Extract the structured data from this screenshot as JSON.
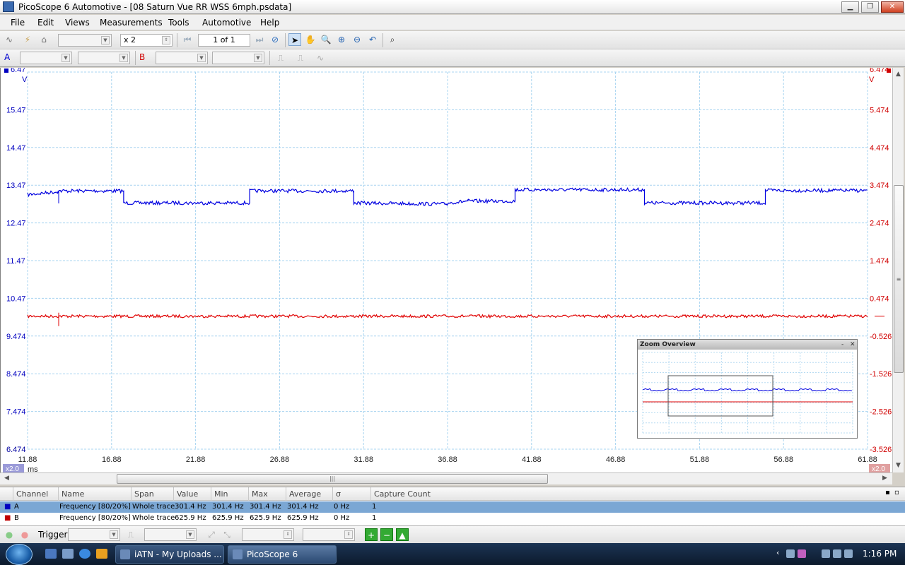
{
  "window": {
    "title": "PicoScope 6 Automotive - [08 Saturn Vue RR WSS 6mph.psdata]",
    "btn_minimize": "▁",
    "btn_maximize": "❐",
    "btn_close": "✕"
  },
  "menu": {
    "items": [
      "File",
      "Edit",
      "Views",
      "Measurements",
      "Tools",
      "Automotive",
      "Help"
    ]
  },
  "toolbar": {
    "zoom_value": "x 2",
    "page_value": "1 of 1"
  },
  "toolbar2": {
    "channel_a": "A",
    "channel_b": "B"
  },
  "plot": {
    "left_axis_labels": [
      "6.47",
      "V",
      "15.47",
      "14.47",
      "13.47",
      "12.47",
      "11.47",
      "10.47",
      "9.474",
      "8.474",
      "7.474",
      "6.474"
    ],
    "right_axis_labels": [
      "6.474",
      "V",
      "5.474",
      "4.474",
      "3.474",
      "2.474",
      "1.474",
      "0.474",
      "-0.526",
      "-1.526",
      "-2.526",
      "-3.526"
    ],
    "x_axis_labels": [
      "11.88",
      "16.88",
      "21.88",
      "26.88",
      "31.88",
      "36.88",
      "41.88",
      "46.88",
      "51.88",
      "56.88",
      "61.88"
    ],
    "x_unit": "ms",
    "zoom_badge_left": "x2.0",
    "zoom_badge_right": "x2.0",
    "colors": {
      "channel_a": "#0000e0",
      "channel_b": "#e00000",
      "grid": "#a8d4f0"
    },
    "zoom_overview_title": "Zoom Overview",
    "zoom_overview_min": "-",
    "zoom_overview_close": "✕"
  },
  "chart_data": {
    "type": "line",
    "title": "",
    "xlabel": "ms",
    "ylabel": "V",
    "xlim": [
      11.88,
      61.88
    ],
    "ylim_left": [
      6.474,
      16.47
    ],
    "ylim_right": [
      -3.526,
      6.474
    ],
    "series": [
      {
        "name": "A",
        "axis": "left",
        "x": [
          11.88,
          13.7,
          13.7,
          17.6,
          17.6,
          25.1,
          25.1,
          31.3,
          31.3,
          36.9,
          36.9,
          38.1,
          38.1,
          40.9,
          40.9,
          48.6,
          48.6,
          55.8,
          55.8,
          61.88
        ],
        "values": [
          13.22,
          13.3,
          13.32,
          13.32,
          13.0,
          13.0,
          13.32,
          13.32,
          13.0,
          12.97,
          13.0,
          13.05,
          13.05,
          13.05,
          13.35,
          13.35,
          13.0,
          13.0,
          13.33,
          13.33
        ]
      },
      {
        "name": "B",
        "axis": "right",
        "x": [
          11.88,
          61.88
        ],
        "values": [
          0.0,
          0.0
        ]
      }
    ]
  },
  "measurements": {
    "headers": [
      "Channel",
      "Name",
      "Span",
      "Value",
      "Min",
      "Max",
      "Average",
      "σ",
      "Capture Count"
    ],
    "rows": [
      {
        "channel": "A",
        "name": "Frequency  [80/20%]",
        "span": "Whole trace",
        "value": "301.4 Hz",
        "min": "301.4 Hz",
        "max": "301.4 Hz",
        "average": "301.4 Hz",
        "sigma": "0 Hz",
        "count": "1"
      },
      {
        "channel": "B",
        "name": "Frequency  [80/20%]",
        "span": "Whole trace",
        "value": "625.9 Hz",
        "min": "625.9 Hz",
        "max": "625.9 Hz",
        "average": "625.9 Hz",
        "sigma": "0 Hz",
        "count": "1"
      }
    ]
  },
  "trigger": {
    "label": "Trigger"
  },
  "taskbar": {
    "tasks": [
      "iATN - My Uploads ...",
      "PicoScope 6 Autom..."
    ],
    "clock": "1:16 PM"
  }
}
